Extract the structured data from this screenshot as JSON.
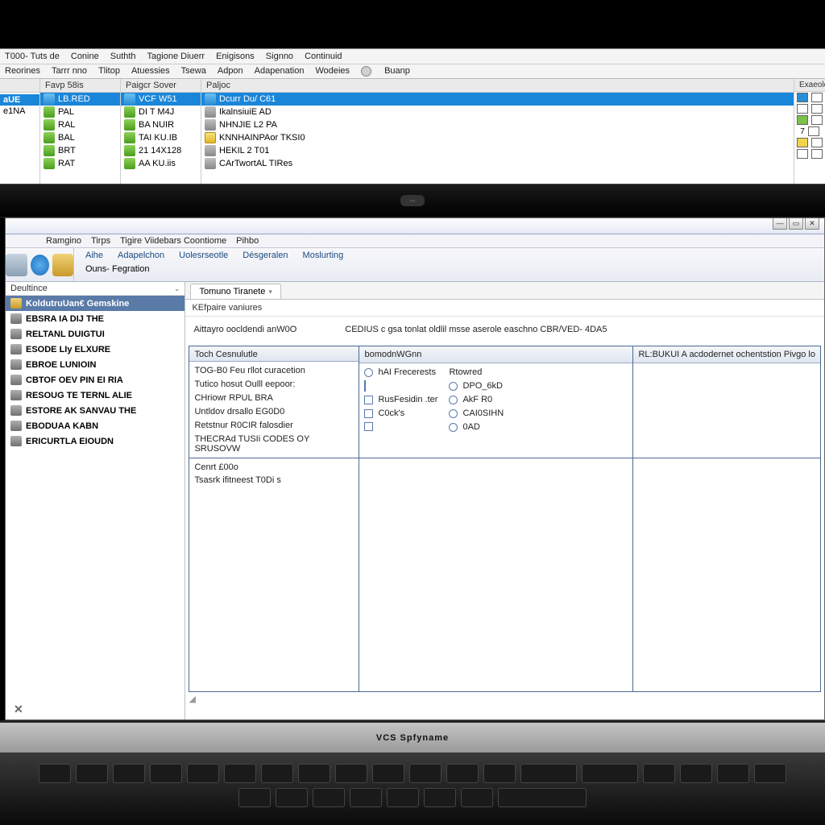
{
  "top_app": {
    "menubar1": [
      "T000- Tuts de",
      "Conine",
      "Suthth",
      "Tagione Diuerr",
      "Enigisons",
      "Signno",
      "Continuid"
    ],
    "menubar2": [
      "Reorines",
      "Tarrr nno",
      "Tlitop",
      "Atuessies",
      "Tsewa",
      "Adpon",
      "Adapenation",
      "Wodeies",
      "Buanp"
    ],
    "col0": {
      "header": "",
      "items": [
        "aUE",
        "e1NA"
      ]
    },
    "col1": {
      "header": "Favp 58is",
      "items": [
        "LB.RED",
        "PAL",
        "RAL",
        "BAL",
        "BRT",
        "RAT"
      ]
    },
    "col2": {
      "header": "Paigcr Sover",
      "items": [
        "VCF W51",
        "DI T M4J",
        "BA NUIR",
        "TAI KU.IB",
        "21 14X128",
        "AA KU.iis"
      ]
    },
    "col3": {
      "header": "Paljoc",
      "items": [
        "Dcurr Du/ C61",
        "IkalnsiuiE AD",
        "NHNJIE L2 PA",
        "KNNHAINPAor TKSI0",
        "HEKIL 2 T01",
        "CArTwortAL TIRes"
      ]
    },
    "col4": {
      "header": "Exaeole"
    }
  },
  "laptop_brand": "VCS Spfyname",
  "app2": {
    "menubar": [
      "Ramgino",
      "Tirps",
      "Tigire Viidebars Coontiome",
      "Pihbo"
    ],
    "toolbar_row1": [
      "Aihe",
      "Adapelchon",
      "Uolesrseotle",
      "Désgeralen",
      "Moslurting"
    ],
    "toolbar_row2": [
      "Ouns- Fegration"
    ],
    "tab_label": "Tomuno Tiranete",
    "sidebar": {
      "header": "Deultince",
      "items": [
        "KoldutruUan€ Gemskine",
        "EBSRA IA DIJ THE",
        "RELTANL DUIGTUI",
        "ESODE LIy ELXURE",
        "EBROE LUNIOIN",
        "CBTOF OEV PIN EI RIA",
        "RESOUG TE TERNL ALIE",
        "ESTORE AK SANVAU THE",
        "EBODUAA KABN",
        "ERICURTLA EIOUDN"
      ]
    },
    "main": {
      "sub_header": "KEfpaire vaniures",
      "desc_left": "Aittayro oocldendi anW0O",
      "desc_right": "CEDIUS c gsa tonlat oldlil msse aserole easchno CBR/VED- 4DA5",
      "grid_headers": [
        "Toch Cesnulutle",
        "bomodnWGnn",
        "RL:BUKUI A acdodernet ochentstion Pivgo lo"
      ],
      "g1_rows": [
        "TOG-B0 Feu rllot curacetion",
        "Tutico hosut Oulll eepoor:",
        "CHriowr RPUL BRA",
        "Untldov drsallo EG0D0",
        "Retstnur R0CIR falosdier",
        "THECRAd TUSIi CODES OY SRUSOVW"
      ],
      "g2_radio_hdr": "Rtowred",
      "g2_radios": [
        "hAI Frecerests",
        "DPO_6kD",
        "AkF R0",
        "CAI0SIHN",
        "0AD"
      ],
      "g2_checks": [
        "RusFesidin .ter",
        "C0ck's",
        ""
      ],
      "grid2_rows": [
        "Cenrt £00o",
        "Tsasrk ifitneest T0Di s"
      ]
    }
  }
}
